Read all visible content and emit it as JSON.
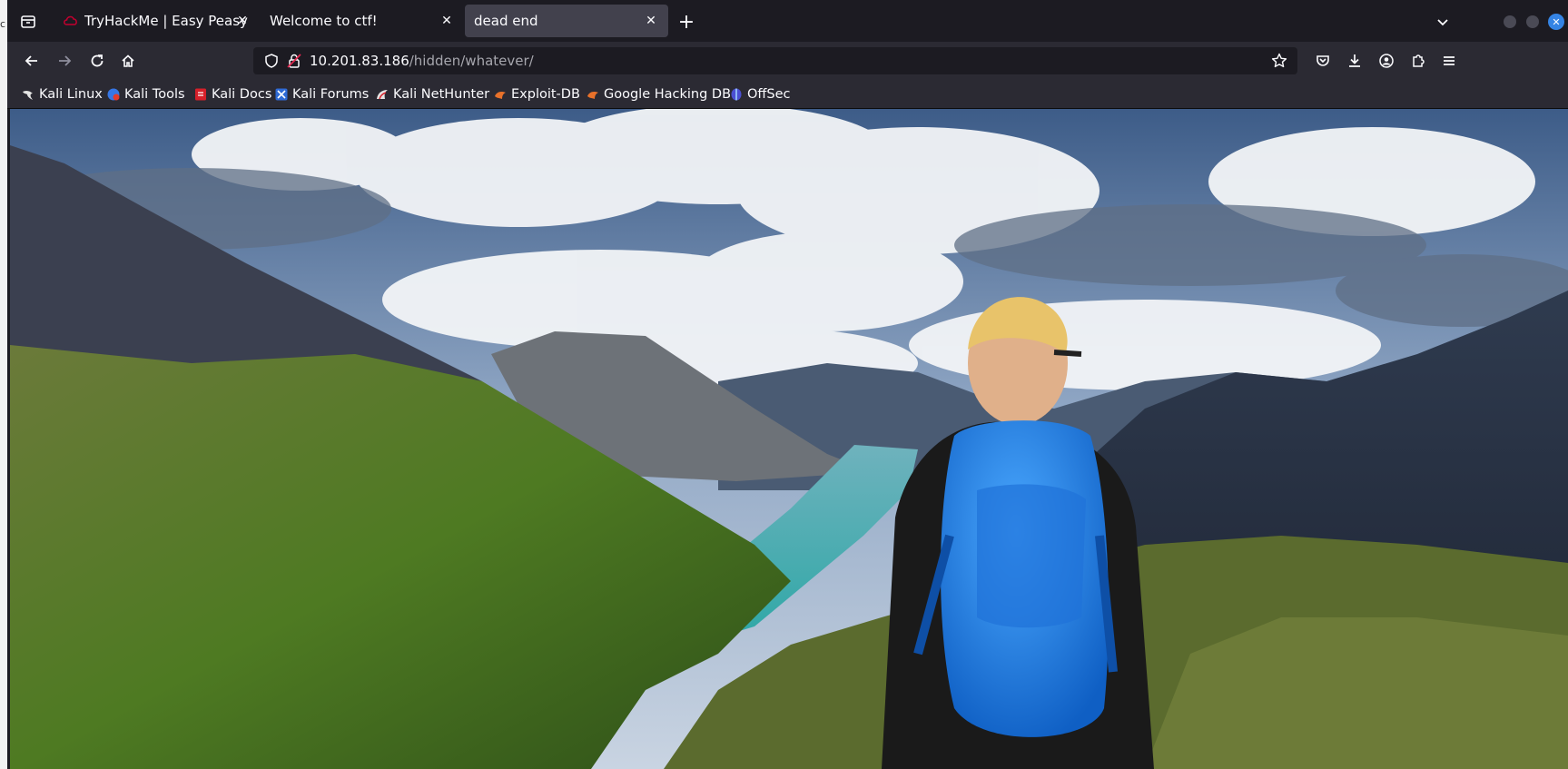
{
  "underlying_window": {
    "fragment": "c"
  },
  "tabs": [
    {
      "title": "TryHackMe | Easy Peasy",
      "favicon": "tryhackme-icon",
      "active": false
    },
    {
      "title": "Welcome to ctf!",
      "favicon": "",
      "active": false
    },
    {
      "title": "dead end",
      "favicon": "",
      "active": true
    }
  ],
  "urlbar": {
    "host": "10.201.83.186",
    "path": "/hidden/whatever/"
  },
  "bookmarks": [
    {
      "label": "Kali Linux",
      "icon": "kali-dragon-icon"
    },
    {
      "label": "Kali Tools",
      "icon": "kali-tools-icon"
    },
    {
      "label": "Kali Docs",
      "icon": "kali-docs-icon"
    },
    {
      "label": "Kali Forums",
      "icon": "kali-forums-icon"
    },
    {
      "label": "Kali NetHunter",
      "icon": "kali-nethunter-icon"
    },
    {
      "label": "Exploit-DB",
      "icon": "exploit-db-icon"
    },
    {
      "label": "Google Hacking DB",
      "icon": "ghdb-icon"
    },
    {
      "label": "OffSec",
      "icon": "offsec-icon"
    }
  ],
  "page": {
    "image_subject": "hiker with blue backpack overlooking a mountain lake valley under cloudy sky"
  },
  "colors": {
    "tabbar_bg": "#1c1b22",
    "toolbar_bg": "#2b2a33",
    "active_tab_bg": "#42414d",
    "text": "#fbfbfe",
    "window_close": "#3584e4"
  }
}
